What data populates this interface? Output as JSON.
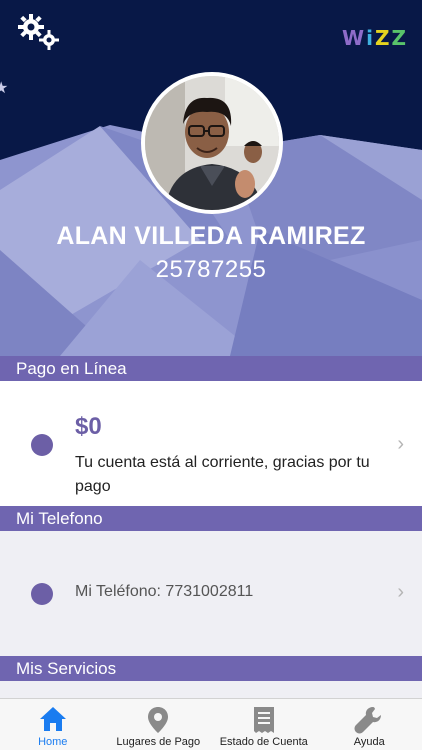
{
  "header": {
    "logo_text": "WiZZ",
    "logo_colors": [
      "#8e6cc9",
      "#3fb0e0",
      "#e5d31f",
      "#59c36a"
    ]
  },
  "user": {
    "name": "ALAN VILLEDA RAMIREZ",
    "account_number": "25787255"
  },
  "sections": {
    "payment": {
      "title": "Pago en Línea",
      "amount": "$0",
      "message": "Tu cuenta está al corriente, gracias por tu pago"
    },
    "phone": {
      "title": "Mi Telefono",
      "text": "Mi Teléfono: 7731002811"
    },
    "services": {
      "title": "Mis Servicios"
    }
  },
  "tabbar": {
    "items": [
      {
        "label": "Home",
        "icon": "home-icon",
        "active": true
      },
      {
        "label": "Lugares de Pago",
        "icon": "location-pin-icon",
        "active": false
      },
      {
        "label": "Estado de Cuenta",
        "icon": "receipt-icon",
        "active": false
      },
      {
        "label": "Ayuda",
        "icon": "wrench-icon",
        "active": false
      }
    ]
  },
  "colors": {
    "hero_bg": "#081847",
    "accent_purple": "#6f65b0",
    "dot_purple": "#6c5fa6",
    "active_tab": "#1a7cf0"
  }
}
